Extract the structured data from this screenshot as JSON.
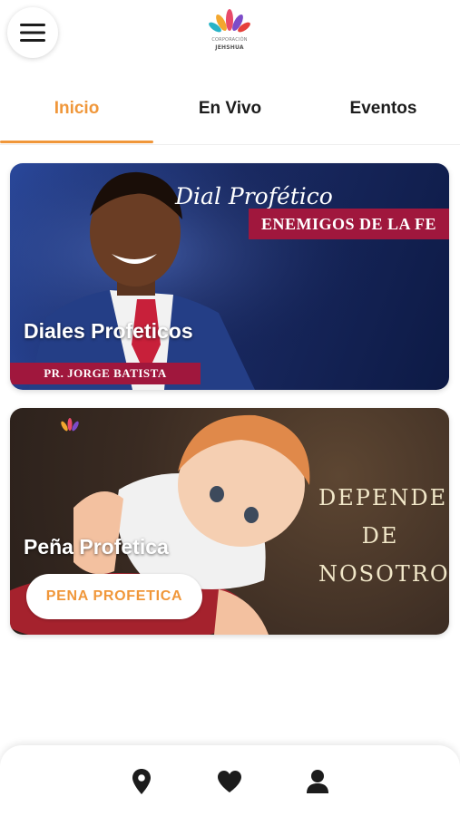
{
  "header": {
    "menu_icon": "hamburger-menu-icon",
    "logo_icon": "lotus-logo-icon",
    "logo_line1": "CORPORACIÓN",
    "logo_line2": "JEHSHUA"
  },
  "tabs": [
    {
      "label": "Inicio",
      "active": true
    },
    {
      "label": "En Vivo",
      "active": false
    },
    {
      "label": "Eventos",
      "active": false
    }
  ],
  "cards": [
    {
      "title": "Diales Profeticos",
      "image_text": {
        "script": "Dial Profético",
        "banner": "ENEMIGOS DE LA FE",
        "pastor": "PR. JORGE BATISTA"
      }
    },
    {
      "title": "Peña Profetica",
      "button_label": "PENA PROFETICA",
      "image_text": {
        "slogan_lines": [
          "DEPENDE",
          "DE",
          "NOSOTROS"
        ]
      }
    }
  ],
  "bottom_nav": {
    "items": [
      {
        "icon": "location-pin-icon"
      },
      {
        "icon": "heart-icon"
      },
      {
        "icon": "user-icon"
      }
    ]
  },
  "colors": {
    "accent": "#f0973a",
    "banner_red": "#a0173d",
    "text_dark": "#1c1c1c"
  }
}
